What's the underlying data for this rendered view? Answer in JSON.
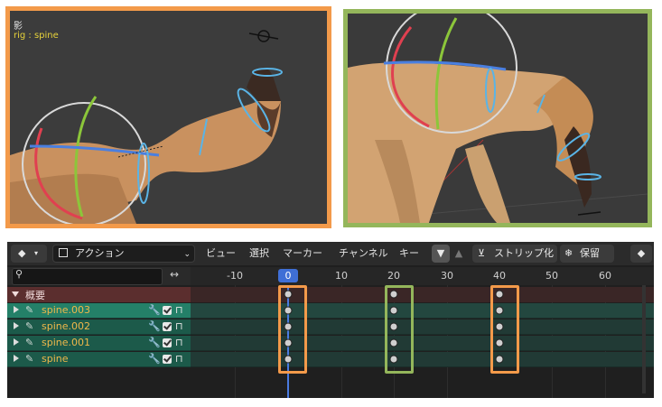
{
  "viewport_left": {
    "title_glyph": "影",
    "rig_label": "rig : spine",
    "border_color": "#f39a4a"
  },
  "viewport_right": {
    "border_color": "#94b65b"
  },
  "dopesheet": {
    "header": {
      "mode_icon": "keyframe-mode-icon",
      "mode_label": "アクション",
      "menus": [
        "ビュー",
        "選択",
        "マーカー",
        "チャンネル",
        "キー"
      ],
      "strip_label": "ストリップ化",
      "stash_label": "保留",
      "strip_icon": "push-down-icon",
      "stash_icon": "snowflake-icon"
    },
    "search": {
      "placeholder": ""
    },
    "ruler": {
      "ticks": [
        "-10",
        "0",
        "10",
        "20",
        "30",
        "40",
        "50",
        "60"
      ],
      "current_frame": "0"
    },
    "summary": {
      "label": "概要"
    },
    "channels": [
      {
        "name": "spine.003",
        "active": true
      },
      {
        "name": "spine.002",
        "active": false
      },
      {
        "name": "spine.001",
        "active": false
      },
      {
        "name": "spine",
        "active": false
      }
    ],
    "keyframes": [
      0,
      20,
      40
    ],
    "highlight_colors": {
      "frame0": "#f39a4a",
      "frame20": "#94b65b",
      "frame40": "#f39a4a"
    }
  }
}
